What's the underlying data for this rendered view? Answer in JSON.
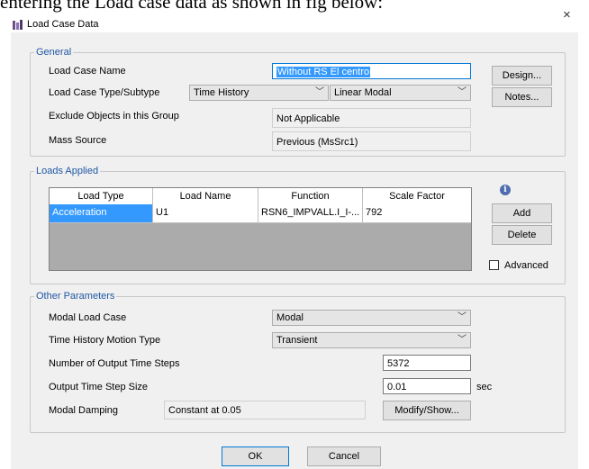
{
  "doc_text": "entering the Load case data as shown in fig below:",
  "dialog": {
    "title": "Load Case Data",
    "close_glyph": "×"
  },
  "general": {
    "legend": "General",
    "load_case_name_label": "Load Case Name",
    "load_case_name_value": "Without RS El centro",
    "type_label": "Load Case Type/Subtype",
    "type_value": "Time History",
    "subtype_value": "Linear Modal",
    "exclude_label": "Exclude Objects in this Group",
    "exclude_value": "Not Applicable",
    "mass_source_label": "Mass Source",
    "mass_source_value": "Previous  (MsSrc1)",
    "design_button": "Design...",
    "notes_button": "Notes..."
  },
  "loads_applied": {
    "legend": "Loads Applied",
    "columns": [
      "Load Type",
      "Load Name",
      "Function",
      "Scale Factor"
    ],
    "rows": [
      [
        "Acceleration",
        "U1",
        "RSN6_IMPVALL.I_I-...",
        "792"
      ]
    ],
    "add_button": "Add",
    "delete_button": "Delete",
    "advanced_label": "Advanced",
    "advanced_checked": false,
    "info_glyph": "i"
  },
  "other_parameters": {
    "legend": "Other Parameters",
    "modal_load_case_label": "Modal Load Case",
    "modal_load_case_value": "Modal",
    "motion_type_label": "Time History Motion Type",
    "motion_type_value": "Transient",
    "output_steps_label": "Number of Output Time Steps",
    "output_steps_value": "5372",
    "step_size_label": "Output Time Step Size",
    "step_size_value": "0.01",
    "step_size_unit": "sec",
    "damping_label": "Modal Damping",
    "damping_value": "Constant at 0.05",
    "modify_button": "Modify/Show..."
  },
  "footer": {
    "ok_button": "OK",
    "cancel_button": "Cancel"
  },
  "icons": {
    "dropdown_arrow": "﹀",
    "app_icon_color": "#6b4f8a"
  }
}
